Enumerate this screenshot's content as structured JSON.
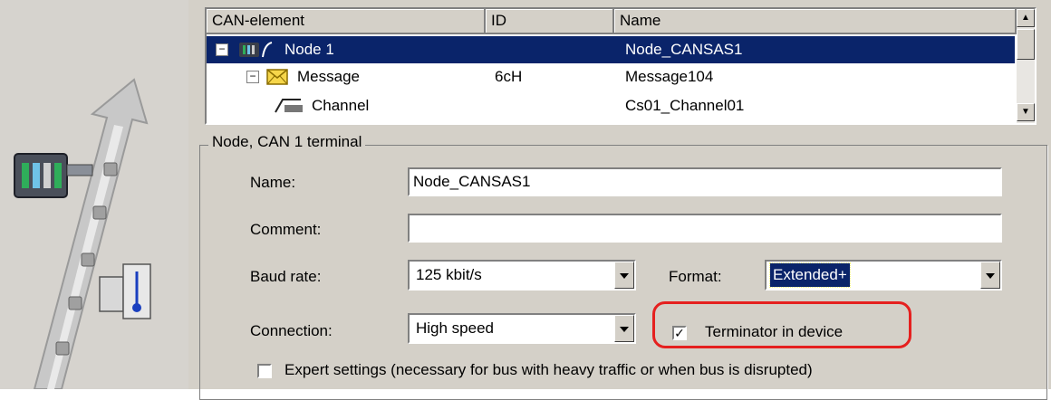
{
  "tree": {
    "columns": [
      "CAN-element",
      "ID",
      "Name"
    ],
    "rows": [
      {
        "element": "Node 1",
        "id": "",
        "name": "Node_CANSAS1",
        "icon": "node-icon",
        "expander": "−",
        "selected": true
      },
      {
        "element": "Message",
        "id": "6cH",
        "name": "Message104",
        "icon": "envelope-icon",
        "expander": "−",
        "selected": false
      },
      {
        "element": "Channel",
        "id": "",
        "name": "Cs01_Channel01",
        "icon": "channel-icon",
        "expander": "",
        "selected": false
      }
    ]
  },
  "group": {
    "title": "Node, CAN 1 terminal",
    "name_label": "Name:",
    "name_value": "Node_CANSAS1",
    "comment_label": "Comment:",
    "comment_value": "",
    "baud_label": "Baud rate:",
    "baud_value": "125 kbit/s",
    "format_label": "Format:",
    "format_value": "Extended+",
    "connection_label": "Connection:",
    "connection_value": "High speed",
    "terminator_label": "Terminator in device",
    "terminator_checked": true,
    "expert_label": "Expert settings (necessary for bus with heavy traffic or when bus is disrupted)",
    "expert_checked": false
  },
  "colors": {
    "selection": "#0a246a",
    "highlight_ring": "#e5201f",
    "dialog_bg": "#d4d0c8"
  }
}
